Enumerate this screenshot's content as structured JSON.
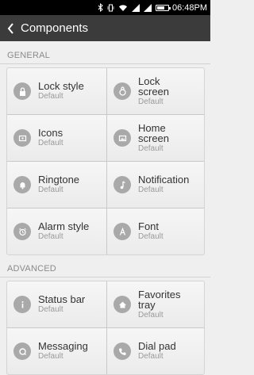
{
  "statusbar": {
    "time": "06:48PM"
  },
  "header": {
    "title": "Components"
  },
  "sections": {
    "general": {
      "title": "GENERAL",
      "items": [
        {
          "label": "Lock style",
          "sub": "Default",
          "icon": "lock-icon"
        },
        {
          "label": "Lock screen",
          "sub": "Default",
          "icon": "lock-screen-icon"
        },
        {
          "label": "Icons",
          "sub": "Default",
          "icon": "icons-icon"
        },
        {
          "label": "Home screen",
          "sub": "Default",
          "icon": "home-screen-icon"
        },
        {
          "label": "Ringtone",
          "sub": "Default",
          "icon": "bell-icon"
        },
        {
          "label": "Notification",
          "sub": "Default",
          "icon": "music-note-icon"
        },
        {
          "label": "Alarm style",
          "sub": "Default",
          "icon": "alarm-clock-icon"
        },
        {
          "label": "Font",
          "sub": "Default",
          "icon": "font-icon"
        }
      ]
    },
    "advanced": {
      "title": "ADVANCED",
      "items": [
        {
          "label": "Status bar",
          "sub": "Default",
          "icon": "info-icon"
        },
        {
          "label": "Favorites tray",
          "sub": "Default",
          "icon": "home-icon"
        },
        {
          "label": "Messaging",
          "sub": "Default",
          "icon": "message-icon"
        },
        {
          "label": "Dial pad",
          "sub": "Default",
          "icon": "phone-icon"
        }
      ]
    }
  },
  "colors": {
    "arrow": "#f06a1e",
    "icon_bg": "#a9a9a9"
  }
}
